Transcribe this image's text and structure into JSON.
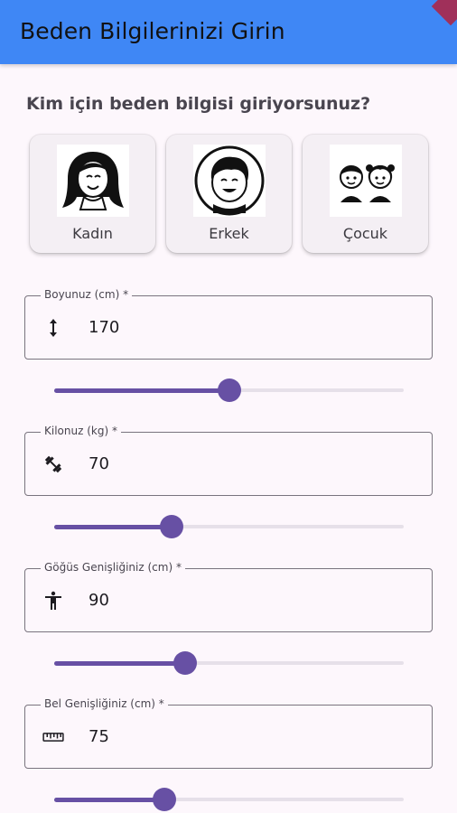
{
  "appbar": {
    "title": "Beden Bilgilerinizi Girin"
  },
  "question": "Kim için beden bilgisi giriyorsunuz?",
  "profiles": [
    {
      "label": "Kadın",
      "icon": "woman-avatar-icon"
    },
    {
      "label": "Erkek",
      "icon": "man-avatar-icon"
    },
    {
      "label": "Çocuk",
      "icon": "children-avatar-icon"
    }
  ],
  "fields": [
    {
      "label": "Boyunuz (cm) *",
      "value": "170",
      "icon": "height-icon",
      "slider_fraction": 0.5
    },
    {
      "label": "Kilonuz (kg) *",
      "value": "70",
      "icon": "fitness-dumbbell-icon",
      "slider_fraction": 0.335
    },
    {
      "label": "Göğüs Genişliğiniz (cm) *",
      "value": "90",
      "icon": "accessibility-person-icon",
      "slider_fraction": 0.375
    },
    {
      "label": "Bel Genişliğiniz (cm) *",
      "value": "75",
      "icon": "ruler-icon",
      "slider_fraction": 0.315
    }
  ],
  "colors": {
    "appbar": "#3f87f5",
    "accent": "#6750a4",
    "track": "#e6e0e9",
    "background": "#fdf7fc"
  }
}
